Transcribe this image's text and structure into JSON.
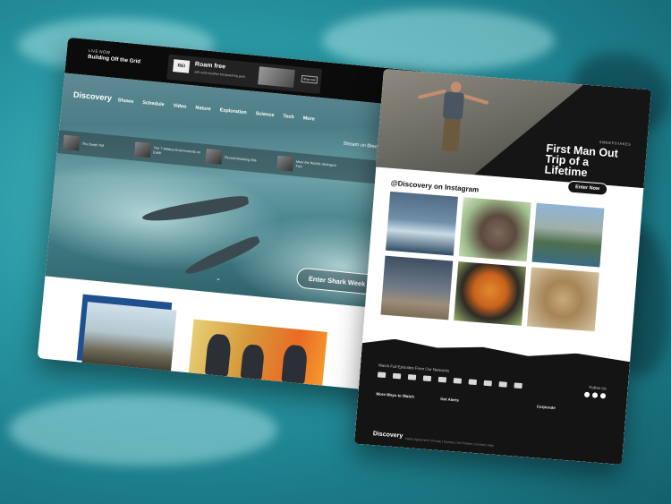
{
  "left_page": {
    "live_label": "LIVE NOW",
    "live_show": "Building Off the Grid",
    "ad": {
      "logo": "REI",
      "title": "Roam free",
      "subtitle": "with cold-weather backpacking gear",
      "button": "Shop now"
    },
    "brand": "Discovery",
    "nav": [
      "Shows",
      "Schedule",
      "Video",
      "Nature",
      "Exploration",
      "Science",
      "Tech",
      "More"
    ],
    "stream_prefix": "Stream on",
    "stream_brand": "Discovery GO",
    "thumbnails": [
      "The Death Toll",
      "The 7 Wildest Environments on Earth",
      "Record Breaking Bite",
      "Meet the Worlds Strangest Fish"
    ],
    "cta": "Enter Shark Week"
  },
  "right_page": {
    "promo_tag": "SWEEPSTAKES",
    "promo_title": "First Man Out Trip of a Lifetime",
    "promo_button": "Enter Now",
    "instagram_title": "@Discovery on Instagram",
    "footer": {
      "network_text": "Watch Full Episodes From Our Networks",
      "follow": "Follow Us",
      "more_ways": "More Ways to Watch",
      "get_alerts": "Get Alerts",
      "corporate": "Corporate",
      "brand": "Discovery",
      "links": "Visitor Agreement | Privacy | Cookies | Ad Choices | Contact | Help"
    }
  },
  "colors": {
    "ocean": "#2a9aa6",
    "dark_ui": "#141414",
    "nav_accent": "#ffffff",
    "card_blue": "#1e4f8f"
  }
}
